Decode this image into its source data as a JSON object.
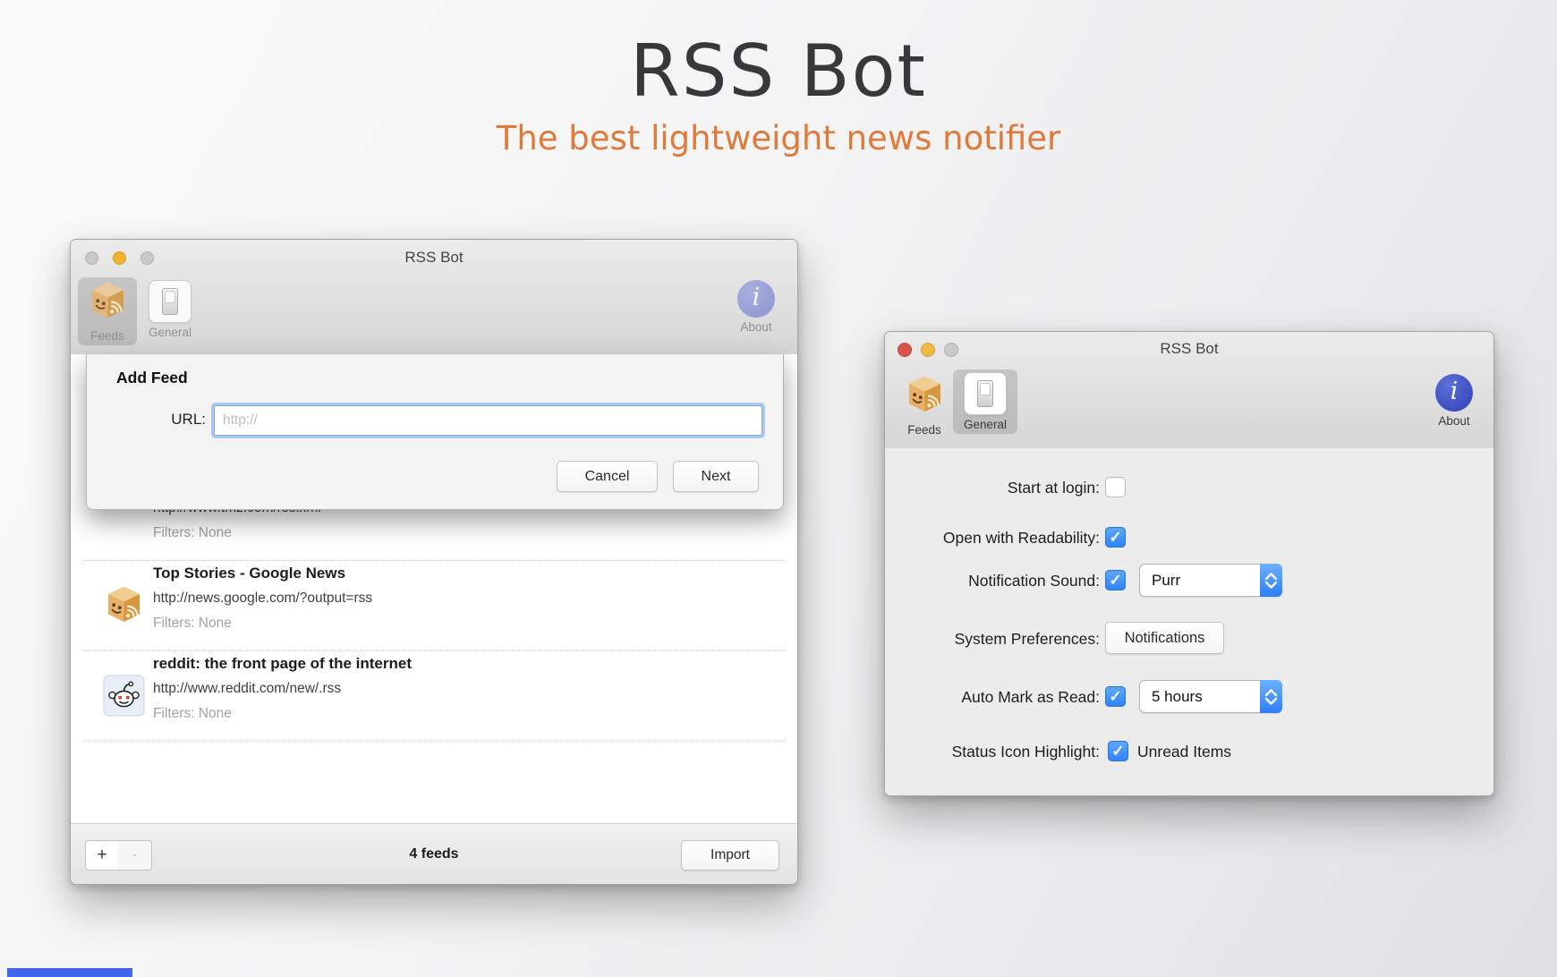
{
  "page": {
    "title": "RSS Bot",
    "subtitle": "The best lightweight news notifier"
  },
  "colors": {
    "subtitle_orange": "#df7a3b",
    "checkbox_blue": "#3f95f5",
    "about_blue": "#3c4cc0",
    "traffic_left": [
      "#c9c9c9",
      "#f2b32c",
      "#c9c9c9"
    ],
    "traffic_right": [
      "#d8554c",
      "#eebb45",
      "#c9c9c9"
    ]
  },
  "feeds_window": {
    "title": "RSS Bot",
    "toolbar": {
      "feeds": "Feeds",
      "general": "General",
      "about": "About"
    },
    "sheet": {
      "title": "Add Feed",
      "url_label": "URL:",
      "url_placeholder": "http://",
      "url_value": "",
      "cancel": "Cancel",
      "next": "Next"
    },
    "feeds": [
      {
        "name": "",
        "url": "http://www.tmz.com/rss.xml",
        "filters": "Filters: None",
        "icon": "tmz-icon"
      },
      {
        "name": "Top Stories - Google News",
        "url": "http://news.google.com/?output=rss",
        "filters": "Filters: None",
        "icon": "rss-bot-cube-icon"
      },
      {
        "name": "reddit: the front page of the internet",
        "url": "http://www.reddit.com/new/.rss",
        "filters": "Filters: None",
        "icon": "reddit-icon"
      }
    ],
    "footer": {
      "add": "+",
      "remove": "-",
      "count": "4 feeds",
      "import": "Import"
    }
  },
  "general_window": {
    "title": "RSS Bot",
    "toolbar": {
      "feeds": "Feeds",
      "general": "General",
      "about": "About"
    },
    "settings": {
      "start_at_login": {
        "label": "Start at login:",
        "checked": false
      },
      "open_with_readability": {
        "label": "Open with Readability:",
        "checked": true
      },
      "notification_sound": {
        "label": "Notification Sound:",
        "checked": true,
        "value": "Purr"
      },
      "system_preferences": {
        "label": "System Preferences:",
        "button": "Notifications"
      },
      "auto_mark_read": {
        "label": "Auto Mark as Read:",
        "checked": true,
        "value": "5 hours"
      },
      "status_icon_highlight": {
        "label": "Status Icon Highlight:",
        "checked": true,
        "value": "Unread Items"
      }
    }
  }
}
